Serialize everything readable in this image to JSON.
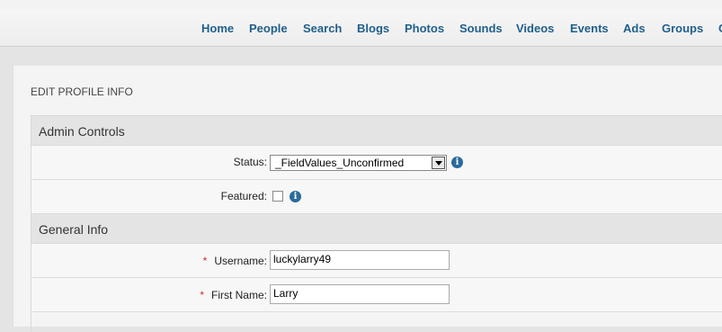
{
  "nav": {
    "items": [
      {
        "id": "home",
        "label": "Home"
      },
      {
        "id": "people",
        "label": "People"
      },
      {
        "id": "search",
        "label": "Search"
      },
      {
        "id": "blogs",
        "label": "Blogs"
      },
      {
        "id": "photos",
        "label": "Photos"
      },
      {
        "id": "sounds",
        "label": "Sounds"
      },
      {
        "id": "videos",
        "label": "Videos"
      },
      {
        "id": "events",
        "label": "Events"
      },
      {
        "id": "ads",
        "label": "Ads"
      },
      {
        "id": "groups",
        "label": "Groups"
      },
      {
        "id": "more",
        "label": "C"
      }
    ]
  },
  "page": {
    "title": "EDIT PROFILE INFO"
  },
  "admin_controls": {
    "heading": "Admin Controls",
    "status": {
      "label": "Status:",
      "value": "_FieldValues_Unconfirmed",
      "info_icon": "info-icon"
    },
    "featured": {
      "label": "Featured:",
      "checked": false,
      "info_icon": "info-icon"
    }
  },
  "general_info": {
    "heading": "General Info",
    "username": {
      "required_mark": "*",
      "label": "Username:",
      "value": "luckylarry49"
    },
    "first_name": {
      "required_mark": "*",
      "label": "First Name:",
      "value": "Larry"
    }
  }
}
